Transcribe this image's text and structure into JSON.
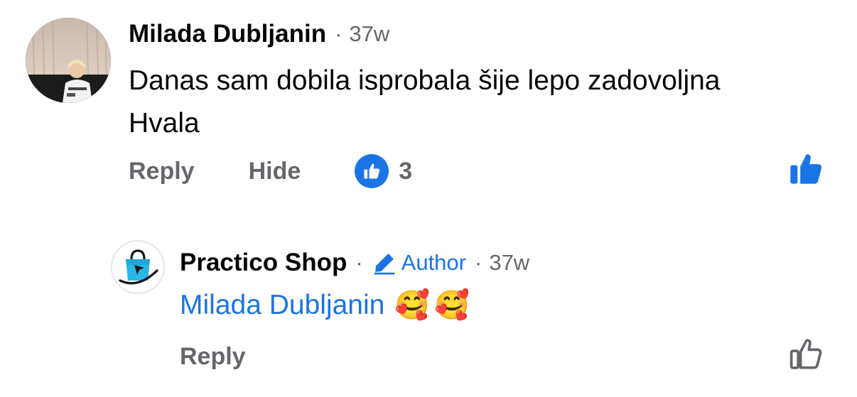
{
  "comment": {
    "author": "Milada Dubljanin",
    "separator": "·",
    "age": "37w",
    "text_line1": "Danas sam dobila isprobala šije lepo zadovoljna",
    "text_line2": "Hvala",
    "actions": {
      "reply": "Reply",
      "hide": "Hide"
    },
    "reaction": {
      "type": "like",
      "count": "3"
    },
    "liked_by_viewer": true
  },
  "reply": {
    "author": "Practico Shop",
    "separator": "·",
    "badge": "Author",
    "separator2": "·",
    "age": "37w",
    "mention": "Milada Dubljanin",
    "emojis": [
      "🥰",
      "🥰"
    ],
    "actions": {
      "reply": "Reply"
    },
    "liked_by_viewer": false
  },
  "colors": {
    "text": "#050505",
    "secondary": "#65676b",
    "accent": "#1b74e4",
    "brand_cyan": "#28b8e8"
  },
  "icons": {
    "reaction": "like-reaction-icon",
    "like_filled": "thumbs-up-filled-icon",
    "like_outline": "thumbs-up-outline-icon",
    "author_badge": "pencil-icon",
    "shop_logo": "shopping-bag-icon"
  }
}
